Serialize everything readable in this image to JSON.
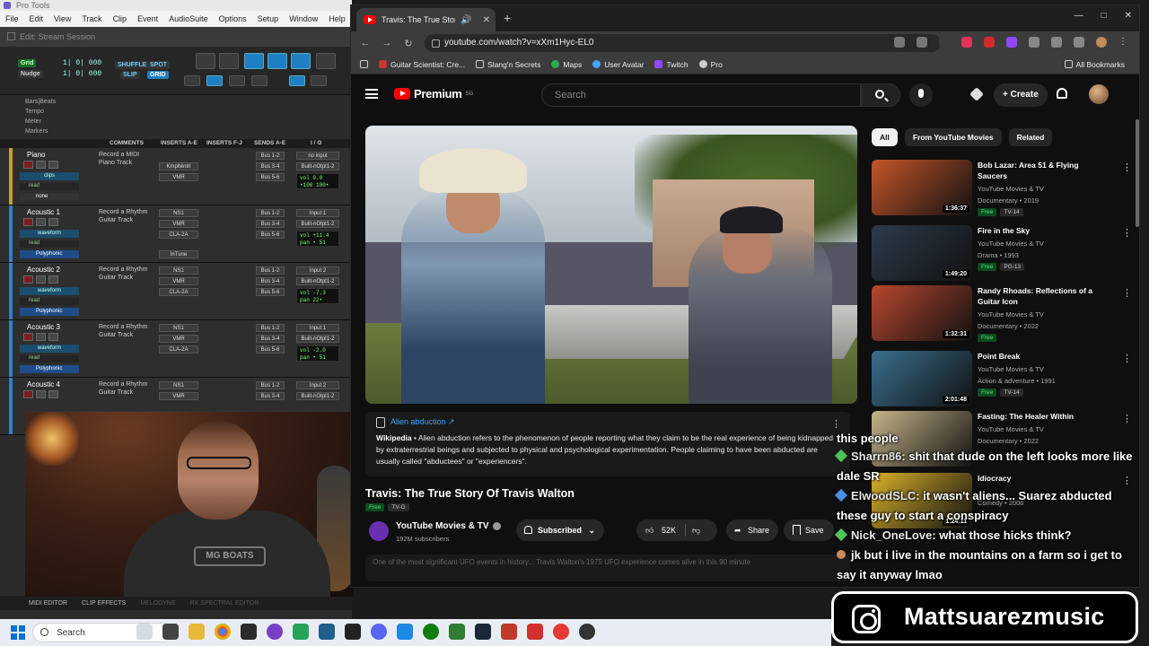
{
  "protools": {
    "app_title": "Pro Tools",
    "menu": [
      "File",
      "Edit",
      "View",
      "Track",
      "Clip",
      "Event",
      "AudioSuite",
      "Options",
      "Setup",
      "Window",
      "Help"
    ],
    "session_title": "Edit: Stream Session",
    "modes": {
      "grid": "Grid",
      "nudge": "Nudge",
      "shuffle": "SHUFFLE",
      "spot": "SPOT",
      "slip": "SLIP",
      "grid2": "GRID"
    },
    "counters": [
      "1| 0| 000",
      "1| 0| 000"
    ],
    "rulers": [
      "Bars|Beats",
      "Tempo",
      "Meter",
      "Markers"
    ],
    "columns": [
      "COMMENTS",
      "INSERTS A-E",
      "INSERTS F-J",
      "SENDS A-E",
      "I / O"
    ],
    "tracks": [
      {
        "name": "Piano",
        "comment": "Record a MIDI Piano Track",
        "view": "clips",
        "inserts": [
          "Kmplténtrl",
          "VMR"
        ],
        "sends": [
          "Bus 1-2",
          "Bus 3-4",
          "Bus 5-6"
        ],
        "io": [
          "no input",
          "Built-nOtpt1-2"
        ],
        "vol": "vol 0.0",
        "pan": "•100 100•",
        "extra": "none",
        "dyn": "read"
      },
      {
        "name": "Acoustic 1",
        "comment": "Record a Rhythm Guitar Track",
        "view": "waveform",
        "inserts": [
          "NS1",
          "VMR",
          "CLA-2A",
          "InTune"
        ],
        "sends": [
          "Bus 1-2",
          "Bus 3-4",
          "Bus 5-6"
        ],
        "io": [
          "Input 1",
          "Built-nOtpt1-2"
        ],
        "vol": "vol +11.4",
        "pan": "pan • 51",
        "extra": "Polyphonic",
        "dyn": "read"
      },
      {
        "name": "Acoustic 2",
        "comment": "Record a Rhythm Guitar Track",
        "view": "waveform",
        "inserts": [
          "NS1",
          "VMR",
          "CLA-2A"
        ],
        "sends": [
          "Bus 1-2",
          "Bus 3-4",
          "Bus 5-6"
        ],
        "io": [
          "Input 2",
          "Built-nOtpt1-2"
        ],
        "vol": "vol -7.3",
        "pan": "pan 22•",
        "extra": "Polyphonic",
        "dyn": "read"
      },
      {
        "name": "Acoustic 3",
        "comment": "Record a Rhythm Guitar Track",
        "view": "waveform",
        "inserts": [
          "NS1",
          "VMR",
          "CLA-2A"
        ],
        "sends": [
          "Bus 1-2",
          "Bus 3-4",
          "Bus 5-6"
        ],
        "io": [
          "Input 1",
          "Built-nOtpt1-2"
        ],
        "vol": "vol -2.0",
        "pan": "pan • 51",
        "extra": "Polyphonic",
        "dyn": "read"
      },
      {
        "name": "Acoustic 4",
        "comment": "Record a Rhythm Guitar Track",
        "view": "waveform",
        "inserts": [
          "NS1",
          "VMR"
        ],
        "sends": [
          "Bus 1-2",
          "Bus 3-4"
        ],
        "io": [
          "Input 2",
          "Built-nOtpt1-2"
        ],
        "vol": "",
        "pan": "",
        "extra": "",
        "dyn": ""
      }
    ],
    "bottom_tabs": [
      "MIDI EDITOR",
      "CLIP EFFECTS",
      "MELODYNE",
      "RX SPECTRAL EDITOR"
    ]
  },
  "webcam": {
    "shirt_text": "MG BOATS"
  },
  "browser": {
    "tab_title": "Travis: The True Story Of Tra",
    "url": "youtube.com/watch?v=xXm1Hyc-EL0",
    "bookmarks": [
      "Guitar Scientist: Cre...",
      "Slang'n Secrets",
      "Maps",
      "User Avatar",
      "Twitch",
      "Pro"
    ],
    "all_bookmarks": "All Bookmarks"
  },
  "youtube": {
    "logo": "Premium",
    "logo_sup": "SG",
    "search_placeholder": "Search",
    "create_label": "Create",
    "infobox": {
      "title": "Alien abduction ↗",
      "source": "Wikipedia",
      "text": " • Alien abduction refers to the phenomenon of people reporting what they claim to be the real experience of being kidnapped by extraterrestrial beings and subjected to physical and psychological experimentation. People claiming to have been abducted are usually called \"abductees\" or \"experiencers\"."
    },
    "video_title": "Travis: The True Story Of Travis Walton",
    "badges": [
      "Free",
      "TV-G"
    ],
    "channel": {
      "name": "YouTube Movies & TV",
      "subs": "192M subscribers"
    },
    "subscribe_label": "Subscribed",
    "likes": "52K",
    "share_label": "Share",
    "save_label": "Save",
    "description_peek": "One of the most significant UFO events in history... Travis Walton's 1975 UFO experience comes alive in this 90 minute",
    "chips": [
      "All",
      "From YouTube Movies",
      "Related"
    ],
    "recommendations": [
      {
        "title": "Bob Lazar: Area 51 & Flying Saucers",
        "channel": "YouTube Movies & TV",
        "meta": "Documentary • 2019",
        "badges": [
          "Free",
          "TV-14"
        ],
        "duration": "1:36:37",
        "thumb_color": "#c4552a"
      },
      {
        "title": "Fire in the Sky",
        "channel": "YouTube Movies & TV",
        "meta": "Drama • 1993",
        "badges": [
          "Free",
          "PG-13"
        ],
        "duration": "1:49:20",
        "thumb_color": "#2c3b4b"
      },
      {
        "title": "Randy Rhoads: Reflections of a Guitar Icon",
        "channel": "YouTube Movies & TV",
        "meta": "Documentary • 2022",
        "badges": [
          "Free"
        ],
        "duration": "1:32:31",
        "thumb_color": "#b8472e"
      },
      {
        "title": "Point Break",
        "channel": "YouTube Movies & TV",
        "meta": "Action & adventure • 1991",
        "badges": [
          "Free",
          "TV-14"
        ],
        "duration": "2:01:48",
        "thumb_color": "#3a6f8f"
      },
      {
        "title": "Fasting: The Healer Within",
        "channel": "YouTube Movies & TV",
        "meta": "Documentary • 2022",
        "badges": [],
        "duration": "",
        "thumb_color": "#c6b58a"
      },
      {
        "title": "Idiocracy",
        "channel": "",
        "meta": "Comedy • 2006",
        "badges": [],
        "duration": "1:24:11",
        "thumb_color": "#d8b02a"
      }
    ]
  },
  "chat": [
    {
      "user": "",
      "msg": "this people"
    },
    {
      "user": "Sharrn86",
      "msg": ": shit that dude on the left looks more like"
    },
    {
      "user": "",
      "msg": "dale SR"
    },
    {
      "user": "ElwoodSLC",
      "msg": ": it wasn't aliens... Suarez abducted"
    },
    {
      "user": "",
      "msg": "these guy to start a conspiracy"
    },
    {
      "user": "Nick_OneLove",
      "msg": ": what those hicks think?"
    },
    {
      "user": "",
      "msg": "jk but i live in the mountains on a farm so i get to"
    },
    {
      "user": "",
      "msg": "say it anyway lmao"
    }
  ],
  "social": {
    "handle": "Mattsuarezmusic"
  },
  "taskbar": {
    "search_label": "Search"
  }
}
